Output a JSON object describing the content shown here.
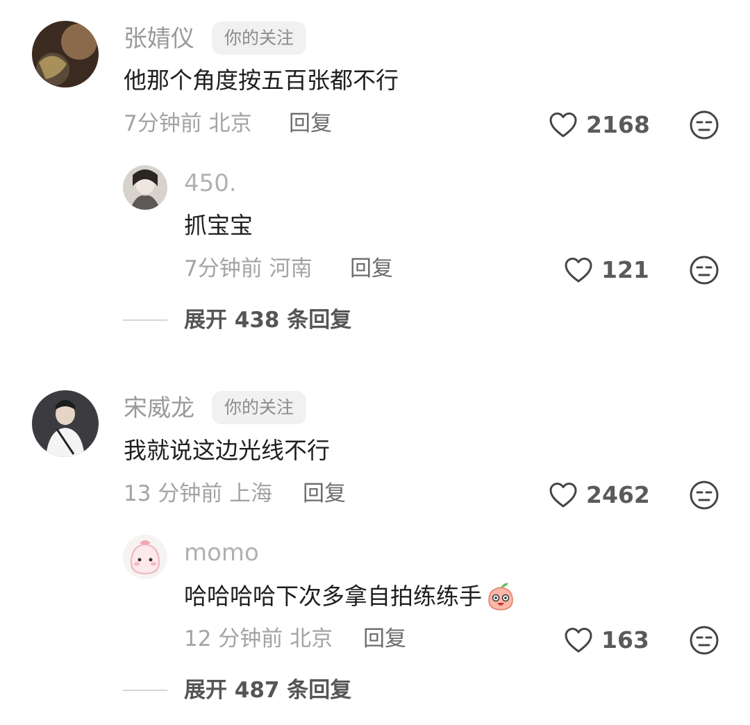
{
  "comments": [
    {
      "user": "张婧仪",
      "tag": "你的关注",
      "text": "他那个角度按五百张都不行",
      "time": "7分钟前",
      "location": "北京",
      "reply_label": "回复",
      "likes": "2168",
      "reply": {
        "user": "450.",
        "text": "抓宝宝",
        "time": "7分钟前",
        "location": "河南",
        "reply_label": "回复",
        "likes": "121"
      },
      "expand": "展开 438 条回复"
    },
    {
      "user": "宋威龙",
      "tag": "你的关注",
      "text": "我就说这边光线不行",
      "time": "13 分钟前",
      "location": "上海",
      "reply_label": "回复",
      "likes": "2462",
      "reply": {
        "user": "momo",
        "text": "哈哈哈哈下次多拿自拍练练手",
        "time": "12 分钟前",
        "location": "北京",
        "reply_label": "回复",
        "likes": "163"
      },
      "expand": "展开 487 条回复"
    }
  ],
  "icons": {
    "like": "heart-outline-icon",
    "dislike": "unamused-face-icon",
    "emoji": "peach-emoji-icon"
  }
}
